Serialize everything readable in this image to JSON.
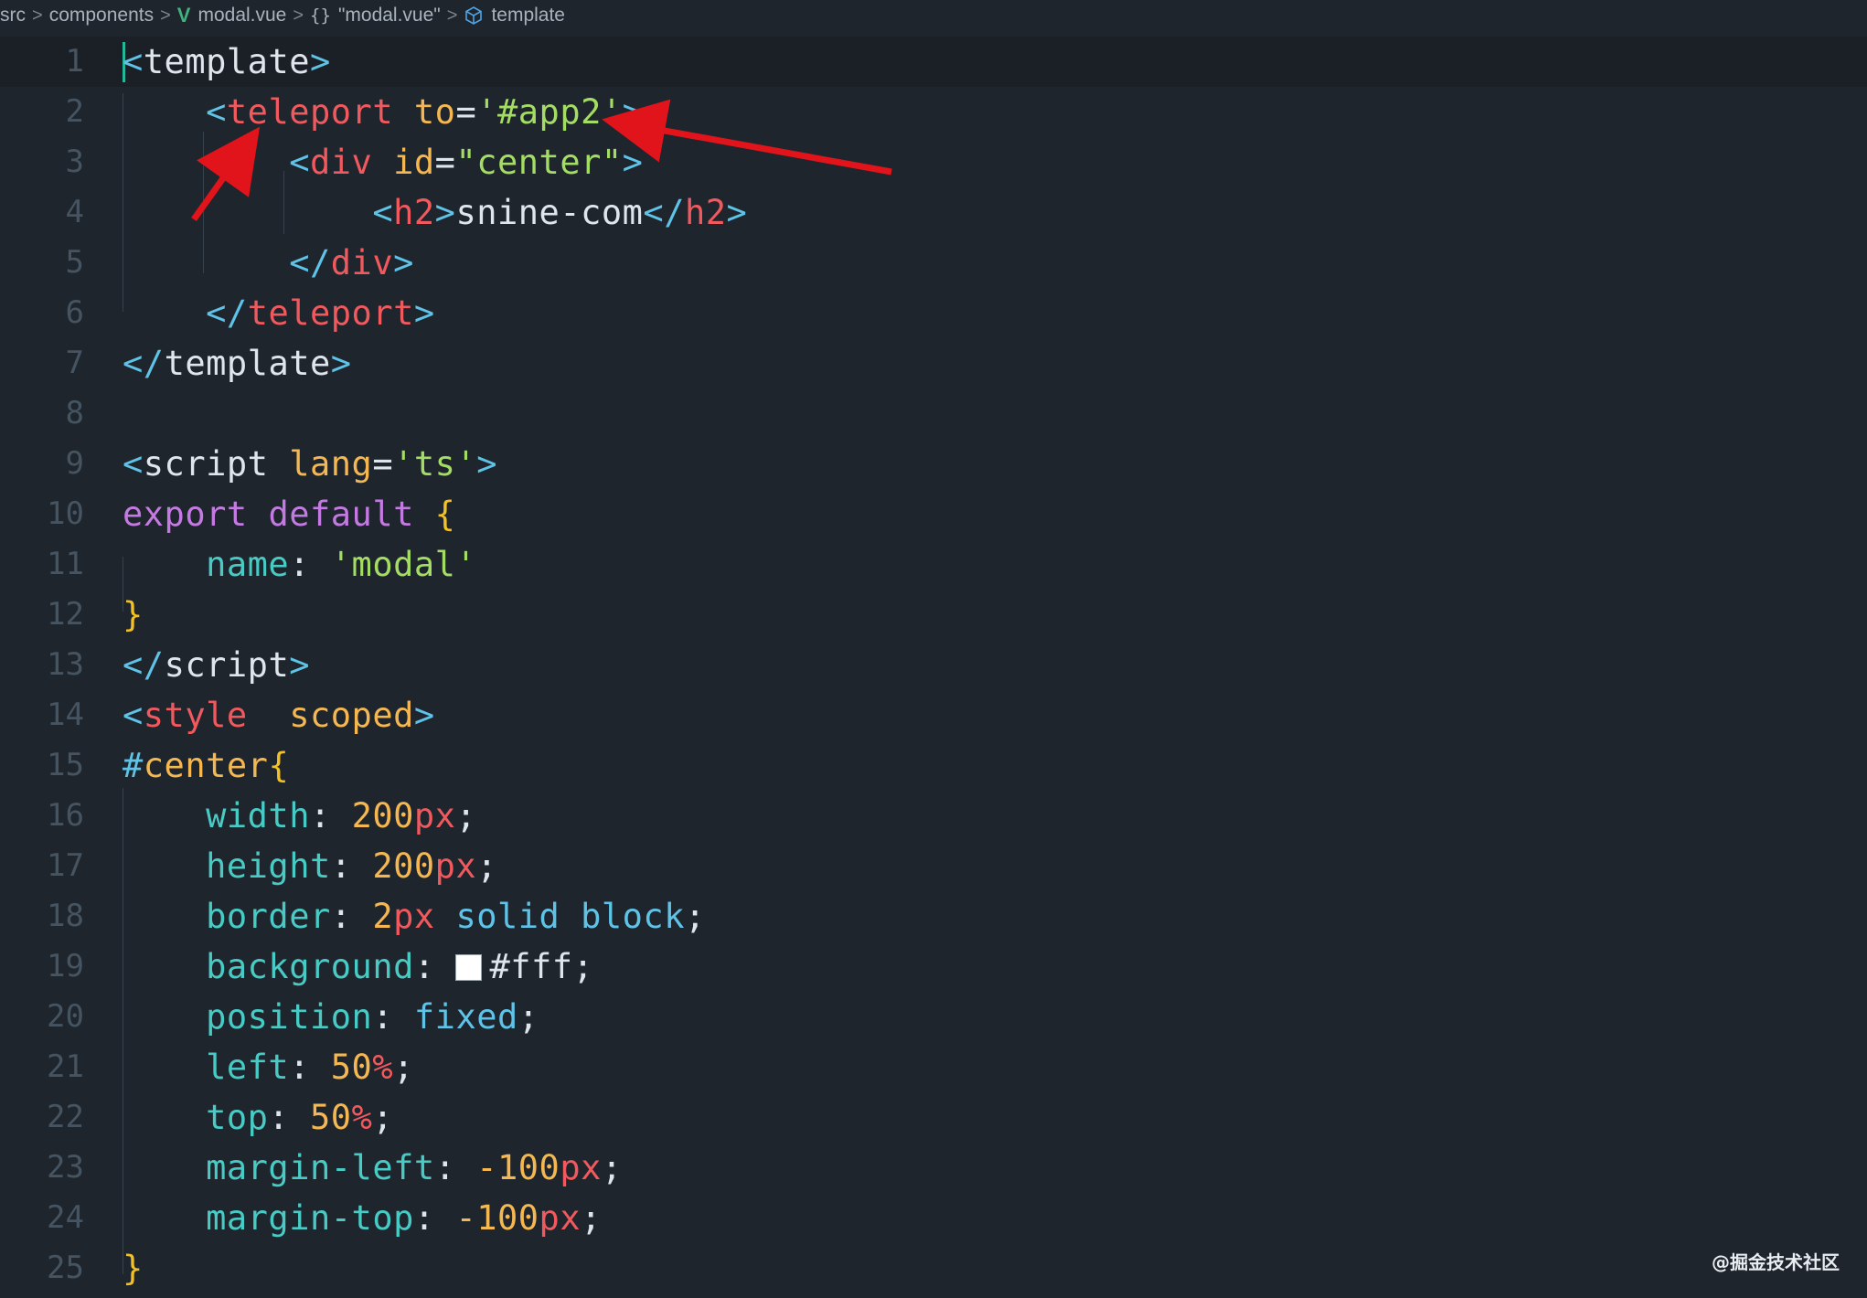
{
  "breadcrumb": {
    "items": [
      "src",
      "components",
      "modal.vue",
      "\"modal.vue\"",
      "template"
    ],
    "object_glyph": "{}",
    "separator": ">",
    "icons": [
      "vue-icon",
      "object-icon",
      "cube-icon"
    ]
  },
  "colors": {
    "background": "#1e252c",
    "punct": "#5fc3e8",
    "tag": "#f0595e",
    "attr": "#f5b751",
    "string": "#a4dd63",
    "keyword": "#c57ae3",
    "prop": "#48cbc5",
    "number": "#f5b751",
    "unit": "#f0595e",
    "brace": "#f2c125",
    "plain": "#dee5ec",
    "arrow": "#e1141c"
  },
  "code": {
    "lines": [
      {
        "n": "1",
        "tokens": [
          [
            "punct",
            "<"
          ],
          [
            "plain",
            "template"
          ],
          [
            "punct",
            ">"
          ]
        ]
      },
      {
        "n": "2",
        "tokens": [
          [
            "plain",
            "    "
          ],
          [
            "punct",
            "<"
          ],
          [
            "tag",
            "teleport"
          ],
          [
            "plain",
            " "
          ],
          [
            "attr",
            "to"
          ],
          [
            "plain",
            "="
          ],
          [
            "string",
            "'#app2'"
          ],
          [
            "punct",
            ">"
          ]
        ]
      },
      {
        "n": "3",
        "tokens": [
          [
            "plain",
            "        "
          ],
          [
            "punct",
            "<"
          ],
          [
            "tag",
            "div"
          ],
          [
            "plain",
            " "
          ],
          [
            "attr",
            "id"
          ],
          [
            "plain",
            "="
          ],
          [
            "string",
            "\"center\""
          ],
          [
            "punct",
            ">"
          ]
        ]
      },
      {
        "n": "4",
        "tokens": [
          [
            "plain",
            "            "
          ],
          [
            "punct",
            "<"
          ],
          [
            "tag",
            "h2"
          ],
          [
            "punct",
            ">"
          ],
          [
            "plain",
            "snine-com"
          ],
          [
            "punct",
            "</"
          ],
          [
            "tag",
            "h2"
          ],
          [
            "punct",
            ">"
          ]
        ]
      },
      {
        "n": "5",
        "tokens": [
          [
            "plain",
            "        "
          ],
          [
            "punct",
            "</"
          ],
          [
            "tag",
            "div"
          ],
          [
            "punct",
            ">"
          ]
        ]
      },
      {
        "n": "6",
        "tokens": [
          [
            "plain",
            "    "
          ],
          [
            "punct",
            "</"
          ],
          [
            "tag",
            "teleport"
          ],
          [
            "punct",
            ">"
          ]
        ]
      },
      {
        "n": "7",
        "tokens": [
          [
            "punct",
            "</"
          ],
          [
            "plain",
            "template"
          ],
          [
            "punct",
            ">"
          ]
        ]
      },
      {
        "n": "8",
        "tokens": []
      },
      {
        "n": "9",
        "tokens": [
          [
            "punct",
            "<"
          ],
          [
            "plain",
            "script"
          ],
          [
            "plain",
            " "
          ],
          [
            "attr",
            "lang"
          ],
          [
            "plain",
            "="
          ],
          [
            "string",
            "'ts'"
          ],
          [
            "punct",
            ">"
          ]
        ]
      },
      {
        "n": "10",
        "tokens": [
          [
            "keyword",
            "export"
          ],
          [
            "plain",
            " "
          ],
          [
            "keyword",
            "default"
          ],
          [
            "plain",
            " "
          ],
          [
            "brace",
            "{"
          ]
        ]
      },
      {
        "n": "11",
        "tokens": [
          [
            "plain",
            "    "
          ],
          [
            "prop",
            "name"
          ],
          [
            "plain",
            ": "
          ],
          [
            "string",
            "'modal'"
          ]
        ]
      },
      {
        "n": "12",
        "tokens": [
          [
            "brace",
            "}"
          ]
        ]
      },
      {
        "n": "13",
        "tokens": [
          [
            "punct",
            "</"
          ],
          [
            "plain",
            "script"
          ],
          [
            "punct",
            ">"
          ]
        ]
      },
      {
        "n": "14",
        "tokens": [
          [
            "punct",
            "<"
          ],
          [
            "tag",
            "style"
          ],
          [
            "plain",
            "  "
          ],
          [
            "attr",
            "scoped"
          ],
          [
            "punct",
            ">"
          ]
        ]
      },
      {
        "n": "15",
        "tokens": [
          [
            "punct",
            "#"
          ],
          [
            "attr",
            "center"
          ],
          [
            "brace",
            "{"
          ]
        ]
      },
      {
        "n": "16",
        "tokens": [
          [
            "plain",
            "    "
          ],
          [
            "prop",
            "width"
          ],
          [
            "plain",
            ": "
          ],
          [
            "number",
            "200"
          ],
          [
            "unit",
            "px"
          ],
          [
            "plain",
            ";"
          ]
        ]
      },
      {
        "n": "17",
        "tokens": [
          [
            "plain",
            "    "
          ],
          [
            "prop",
            "height"
          ],
          [
            "plain",
            ": "
          ],
          [
            "number",
            "200"
          ],
          [
            "unit",
            "px"
          ],
          [
            "plain",
            ";"
          ]
        ]
      },
      {
        "n": "18",
        "tokens": [
          [
            "plain",
            "    "
          ],
          [
            "prop",
            "border"
          ],
          [
            "plain",
            ": "
          ],
          [
            "number",
            "2"
          ],
          [
            "unit",
            "px"
          ],
          [
            "plain",
            " "
          ],
          [
            "punct",
            "solid block"
          ],
          [
            "plain",
            ";"
          ]
        ]
      },
      {
        "n": "19",
        "tokens": [
          [
            "plain",
            "    "
          ],
          [
            "prop",
            "background"
          ],
          [
            "plain",
            ": "
          ],
          [
            "swatch",
            ""
          ],
          [
            "plain",
            "#fff;"
          ]
        ]
      },
      {
        "n": "20",
        "tokens": [
          [
            "plain",
            "    "
          ],
          [
            "prop",
            "position"
          ],
          [
            "plain",
            ": "
          ],
          [
            "punct",
            "fixed"
          ],
          [
            "plain",
            ";"
          ]
        ]
      },
      {
        "n": "21",
        "tokens": [
          [
            "plain",
            "    "
          ],
          [
            "prop",
            "left"
          ],
          [
            "plain",
            ": "
          ],
          [
            "number",
            "50"
          ],
          [
            "unit",
            "%"
          ],
          [
            "plain",
            ";"
          ]
        ]
      },
      {
        "n": "22",
        "tokens": [
          [
            "plain",
            "    "
          ],
          [
            "prop",
            "top"
          ],
          [
            "plain",
            ": "
          ],
          [
            "number",
            "50"
          ],
          [
            "unit",
            "%"
          ],
          [
            "plain",
            ";"
          ]
        ]
      },
      {
        "n": "23",
        "tokens": [
          [
            "plain",
            "    "
          ],
          [
            "prop",
            "margin-left"
          ],
          [
            "plain",
            ": "
          ],
          [
            "number",
            "-100"
          ],
          [
            "unit",
            "px"
          ],
          [
            "plain",
            ";"
          ]
        ]
      },
      {
        "n": "24",
        "tokens": [
          [
            "plain",
            "    "
          ],
          [
            "prop",
            "margin-top"
          ],
          [
            "plain",
            ": "
          ],
          [
            "number",
            "-100"
          ],
          [
            "unit",
            "px"
          ],
          [
            "plain",
            ";"
          ]
        ]
      },
      {
        "n": "25",
        "tokens": [
          [
            "brace",
            "}"
          ]
        ]
      }
    ]
  },
  "watermark": "@掘金技术社区"
}
